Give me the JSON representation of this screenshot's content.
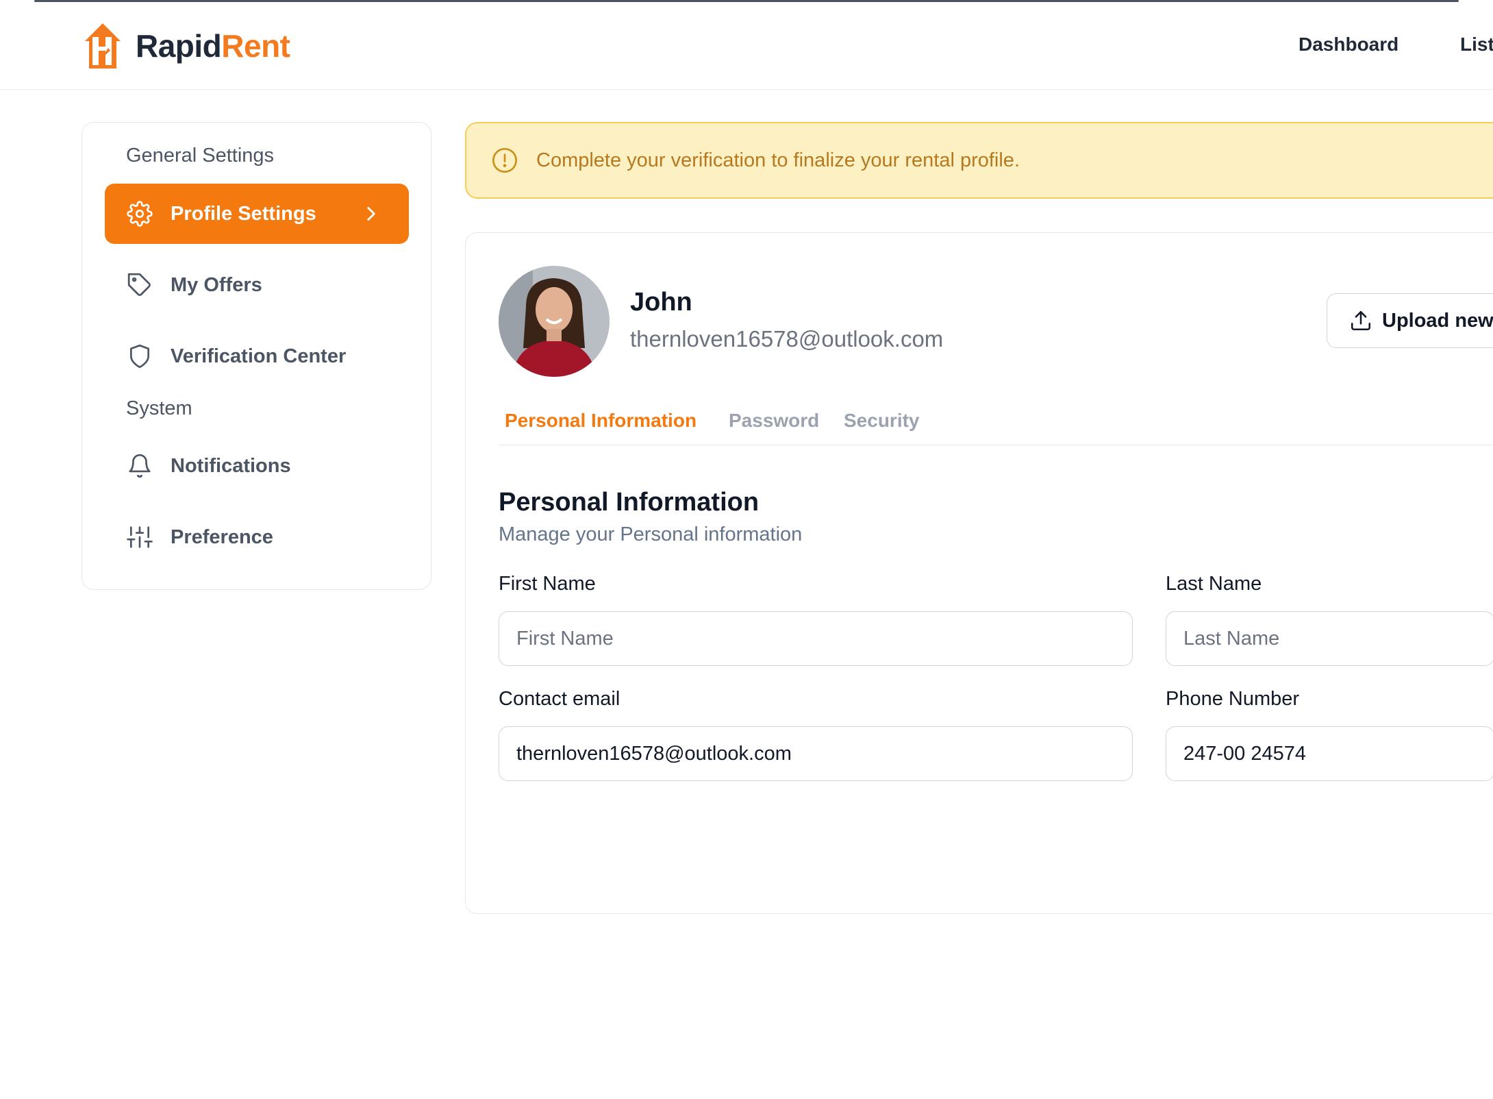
{
  "header": {
    "logo_part1": "Rapid",
    "logo_part2": "Rent",
    "nav": [
      "Dashboard",
      "List"
    ]
  },
  "sidebar": {
    "general_label": "General Settings",
    "system_label": "System",
    "items": [
      {
        "label": "Profile Settings",
        "icon": "gear-icon",
        "active": true
      },
      {
        "label": "My Offers",
        "icon": "tag-icon"
      },
      {
        "label": "Verification Center",
        "icon": "shield-icon"
      },
      {
        "label": "Notifications",
        "icon": "bell-icon"
      },
      {
        "label": "Preference",
        "icon": "sliders-icon"
      }
    ]
  },
  "alert": {
    "text": "Complete your verification to finalize your rental profile.",
    "icon": "alert-circle-icon"
  },
  "profile": {
    "name": "John",
    "email": "thernloven16578@outlook.com",
    "upload_label": "Upload new"
  },
  "tabs": [
    {
      "label": "Personal Information",
      "active": true
    },
    {
      "label": "Password"
    },
    {
      "label": "Security"
    }
  ],
  "form": {
    "title": "Personal Information",
    "subtitle": "Manage your Personal information",
    "first_name": {
      "label": "First Name",
      "placeholder": "First Name",
      "value": ""
    },
    "last_name": {
      "label": "Last Name",
      "placeholder": "Last Name",
      "value": ""
    },
    "email": {
      "label": "Contact email",
      "value": "thernloven16578@outlook.com"
    },
    "phone": {
      "label": "Phone Number",
      "value": "247-00 24574"
    }
  },
  "colors": {
    "accent": "#f47a0f",
    "alert_bg": "#fdf1c3",
    "alert_border": "#f5cf55",
    "alert_text": "#b7791f"
  }
}
